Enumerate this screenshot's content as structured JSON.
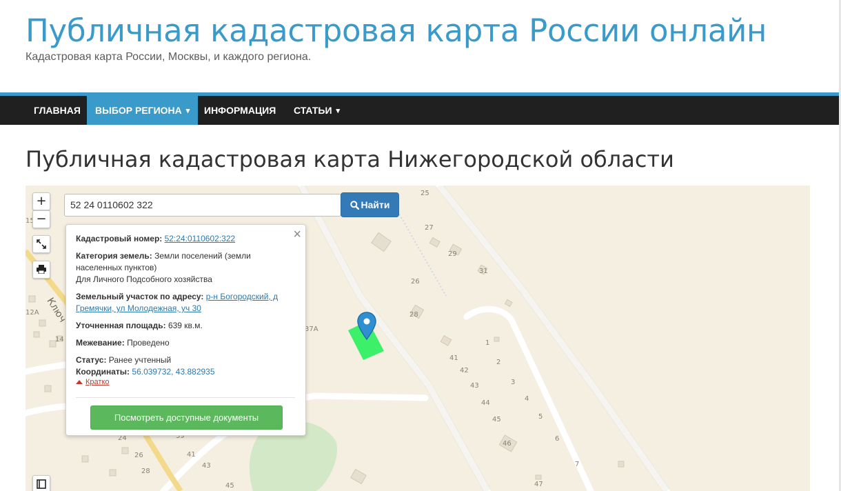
{
  "site": {
    "title": "Публичная кадастровая карта России онлайн",
    "description": "Кадастровая карта России, Москвы, и каждого региона."
  },
  "nav": {
    "items": [
      {
        "label": "ГЛАВНАЯ"
      },
      {
        "label": "ВЫБОР РЕГИОНА",
        "caret": "⌄"
      },
      {
        "label": "ИНФОРМАЦИЯ"
      },
      {
        "label": "СТАТЬИ",
        "caret": "⌄"
      }
    ],
    "active_item": "ВЫБОР РЕГИОНА"
  },
  "page": {
    "title": "Публичная кадастровая карта Нижегородской области"
  },
  "map": {
    "controls": {
      "zoom_in": "+",
      "zoom_out": "−",
      "fullscreen": "fullscreen-icon",
      "print": "print-icon",
      "layers": "layers-icon"
    },
    "search": {
      "value": "52 24 0110602 322",
      "button_label": "Найти"
    },
    "street_label": "Ключ",
    "house_numbers": [
      "15",
      "12А",
      "14",
      "25",
      "27",
      "29",
      "31",
      "26",
      "28",
      "37А",
      "1",
      "2",
      "3",
      "4",
      "5",
      "6",
      "7",
      "41",
      "42",
      "43",
      "44",
      "45",
      "46",
      "47",
      "24",
      "26",
      "28",
      "39",
      "41",
      "43",
      "45"
    ],
    "colors": {
      "parcel": "#39f06a",
      "marker": "#2f8fd0",
      "road": "#ffffff",
      "background": "#f5efe2",
      "green_area": "#cfe7c1"
    }
  },
  "popup": {
    "cadastral_label": "Кадастровый номер:",
    "cadastral_value": "52:24:0110602:322",
    "category_label": "Категория земель:",
    "category_value": "Земли поселений (земли населенных пунктов)",
    "use_value": "Для Личного Подсобного хозяйства",
    "address_label": "Земельный участок по адресу:",
    "address_value": "р-н Богородский, д Гремячки, ул Молодежная, уч 30",
    "area_label": "Уточненная площадь:",
    "area_value": "639 кв.м.",
    "survey_label": "Межевание:",
    "survey_value": "Проведено",
    "status_label": "Статус:",
    "status_value": "Ранее учтенный",
    "coords_label": "Координаты:",
    "coords_value": "56.039732, 43.882935",
    "toggle_label": "Кратко",
    "docs_button": "Посмотреть доступные документы",
    "close": "×"
  }
}
